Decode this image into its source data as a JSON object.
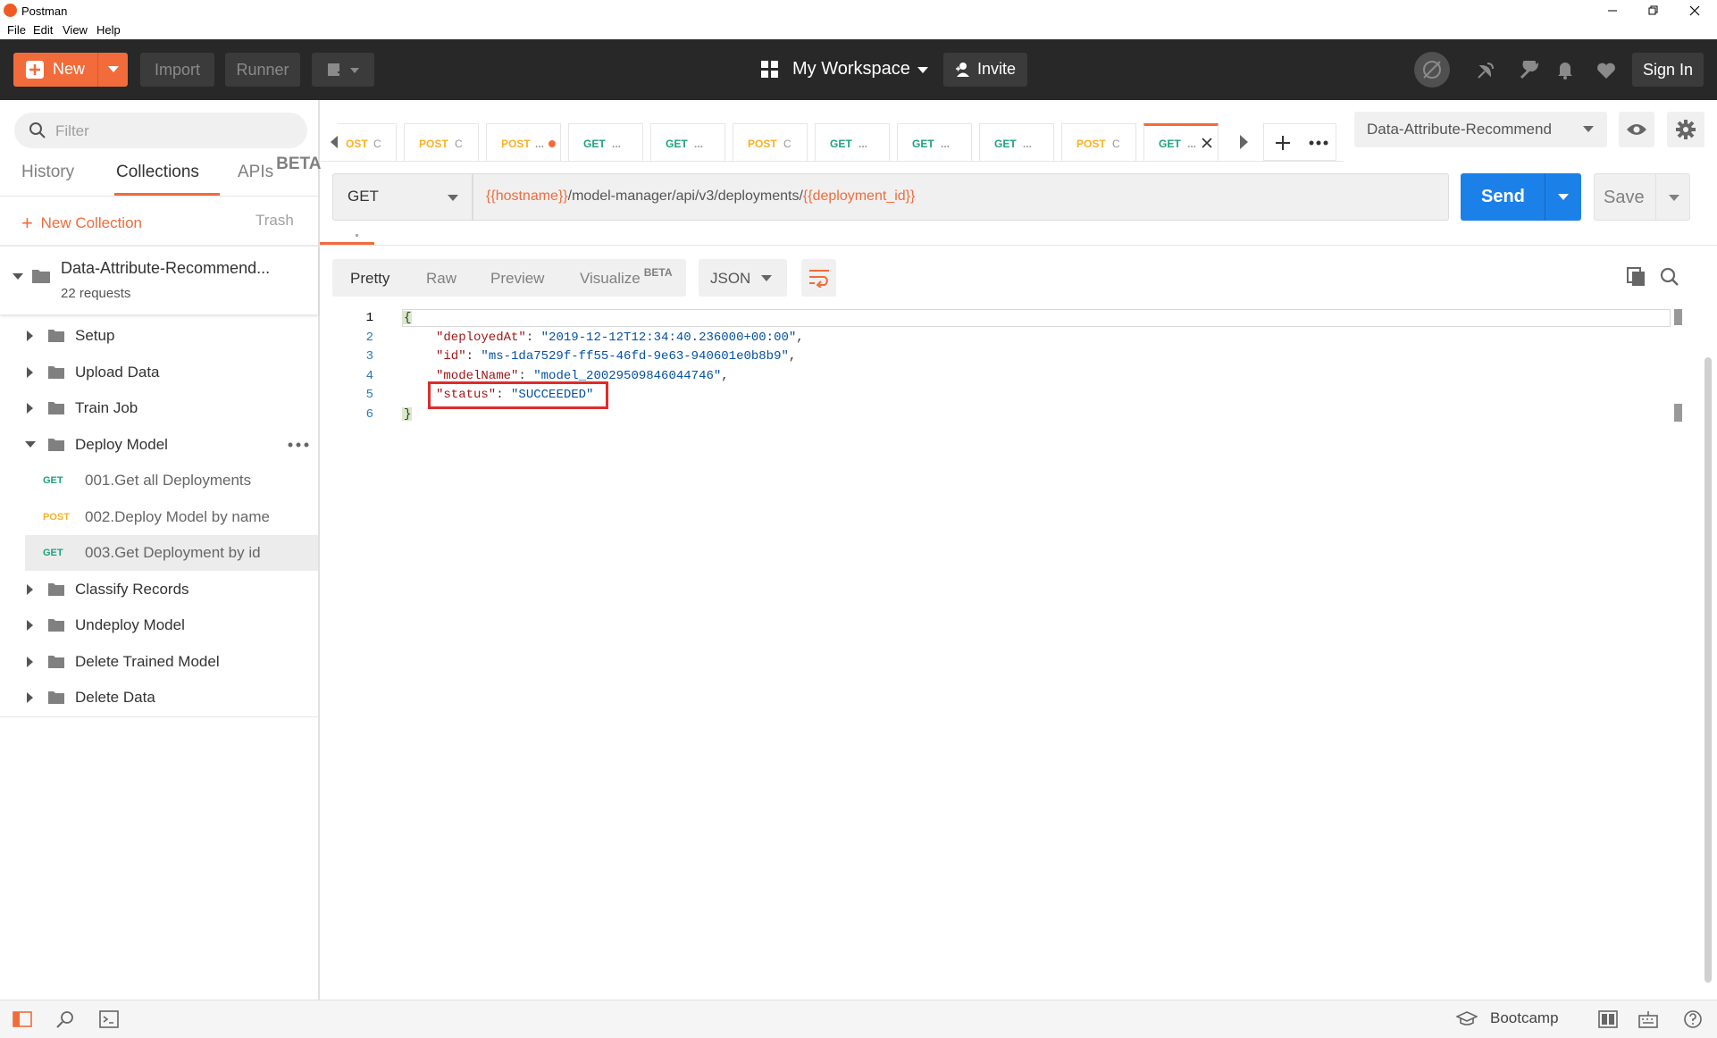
{
  "window": {
    "title": "Postman"
  },
  "menu": [
    "File",
    "Edit",
    "View",
    "Help"
  ],
  "header": {
    "new_label": "New",
    "import_label": "Import",
    "runner_label": "Runner",
    "workspace_label": "My Workspace",
    "invite_label": "Invite",
    "signin_label": "Sign In"
  },
  "sidebar": {
    "filter_placeholder": "Filter",
    "tabs": {
      "history": "History",
      "collections": "Collections",
      "apis": "APIs",
      "apis_badge": "BETA"
    },
    "new_collection": "New Collection",
    "trash": "Trash",
    "collection": {
      "name": "Data-Attribute-Recommend...",
      "count": "22 requests"
    },
    "folders": [
      {
        "label": "Setup"
      },
      {
        "label": "Upload Data"
      },
      {
        "label": "Train Job"
      },
      {
        "label": "Deploy Model",
        "expanded": true
      },
      {
        "label": "Classify Records"
      },
      {
        "label": "Undeploy Model"
      },
      {
        "label": "Delete Trained Model"
      },
      {
        "label": "Delete Data"
      }
    ],
    "requests": [
      {
        "method": "GET",
        "label": "001.Get all Deployments"
      },
      {
        "method": "POST",
        "label": "002.Deploy Model by name"
      },
      {
        "method": "GET",
        "label": "003.Get Deployment by id",
        "selected": true
      }
    ]
  },
  "tabs": [
    {
      "method": "OST",
      "suffix": "C"
    },
    {
      "method": "POST",
      "suffix": "C"
    },
    {
      "method": "POST",
      "suffix": "..."
    },
    {
      "method": "GET",
      "suffix": "..."
    },
    {
      "method": "GET",
      "suffix": "..."
    },
    {
      "method": "POST",
      "suffix": "C"
    },
    {
      "method": "GET",
      "suffix": "..."
    },
    {
      "method": "GET",
      "suffix": "..."
    },
    {
      "method": "GET",
      "suffix": "..."
    },
    {
      "method": "POST",
      "suffix": "C"
    },
    {
      "method": "GET",
      "suffix": "...",
      "active": true
    }
  ],
  "environment": {
    "selected": "Data-Attribute-Recommend"
  },
  "request": {
    "method": "GET",
    "url_var1": "{{hostname}}",
    "url_path": "/model-manager/api/v3/deployments/",
    "url_var2": "{{deployment_id}}",
    "send_label": "Send",
    "save_label": "Save"
  },
  "response": {
    "views": {
      "pretty": "Pretty",
      "raw": "Raw",
      "preview": "Preview",
      "visualize": "Visualize",
      "visualize_badge": "BETA"
    },
    "format": "JSON",
    "lines": [
      {
        "n": "1",
        "key": "",
        "value": "{"
      },
      {
        "n": "2",
        "key": "\"deployedAt\"",
        "value": "\"2019-12-12T12:34:40.236000+00:00\""
      },
      {
        "n": "3",
        "key": "\"id\"",
        "value": "\"ms-1da7529f-ff55-46fd-9e63-940601e0b8b9\""
      },
      {
        "n": "4",
        "key": "\"modelName\"",
        "value": "\"model_20029509846044746\""
      },
      {
        "n": "5",
        "key": "\"status\"",
        "value": "\"SUCCEEDED\""
      },
      {
        "n": "6",
        "key": "",
        "value": "}"
      }
    ]
  },
  "footer": {
    "bootcamp": "Bootcamp"
  },
  "colors": {
    "accent": "#f26b3a",
    "send": "#1c80e9",
    "get": "#1da37f",
    "post": "#fdb022",
    "highlight": "#e02b2b"
  }
}
